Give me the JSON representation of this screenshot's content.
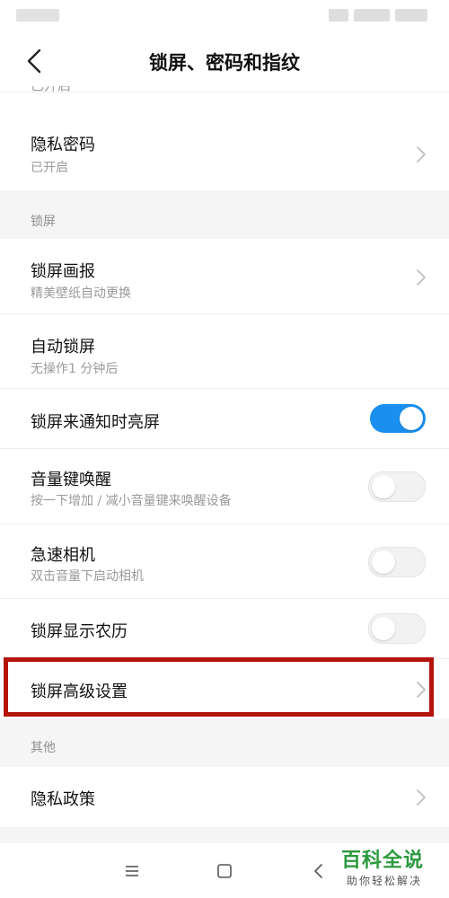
{
  "header": {
    "title": "锁屏、密码和指纹"
  },
  "items_top": [
    {
      "title": "隐私密码",
      "subtitle": "已开启"
    }
  ],
  "sections": {
    "lockscreen": {
      "label": "锁屏"
    },
    "other": {
      "label": "其他"
    }
  },
  "lockscreen_items": [
    {
      "title": "锁屏画报",
      "subtitle": "精美壁纸自动更换"
    },
    {
      "title": "自动锁屏",
      "subtitle": "无操作1 分钟后"
    },
    {
      "title": "锁屏来通知时亮屏",
      "toggle": true
    },
    {
      "title": "音量键唤醒",
      "subtitle": "按一下增加 / 减小音量键来唤醒设备",
      "toggle": false
    },
    {
      "title": "急速相机",
      "subtitle": "双击音量下启动相机",
      "toggle": false
    },
    {
      "title": "锁屏显示农历",
      "toggle": false
    },
    {
      "title": "锁屏高级设置"
    }
  ],
  "other_items": [
    {
      "title": "隐私政策"
    }
  ],
  "colors": {
    "toggle_on": "#1b8ff0",
    "highlight_border": "#b3140c",
    "watermark_green": "#2d9a3f"
  },
  "watermark": {
    "main": "百科全说",
    "sub": "助你轻松解决"
  },
  "nav_icons": [
    "menu-icon",
    "home-icon",
    "back-icon"
  ]
}
